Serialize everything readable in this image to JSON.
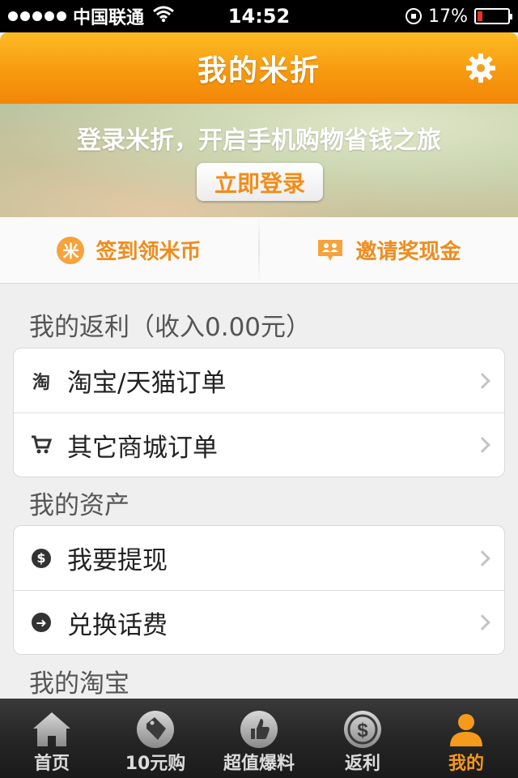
{
  "status_bar": {
    "carrier": "中国联通",
    "time": "14:52",
    "battery": "17%",
    "battery_level": 0.17
  },
  "header": {
    "title": "我的米折",
    "icon": "gear-icon"
  },
  "banner": {
    "text": "登录米折，开启手机购物省钱之旅",
    "login_label": "立即登录"
  },
  "actions": [
    {
      "label": "签到领米币",
      "icon": "mi-coin-icon",
      "icon_glyph": "米"
    },
    {
      "label": "邀请奖现金",
      "icon": "invite-icon"
    }
  ],
  "sections": [
    {
      "title": "我的返利（收入0.00元）",
      "rows": [
        {
          "label": "淘宝/天猫订单",
          "icon": "taobao-icon",
          "icon_glyph": "淘"
        },
        {
          "label": "其它商城订单",
          "icon": "cart-icon"
        }
      ]
    },
    {
      "title": "我的资产",
      "rows": [
        {
          "label": "我要提现",
          "icon": "dollar-icon",
          "icon_glyph": "$"
        },
        {
          "label": "兑换话费",
          "icon": "arrow-right-icon",
          "icon_glyph": "➜"
        }
      ]
    },
    {
      "title": "我的淘宝",
      "rows": []
    }
  ],
  "tabbar": [
    {
      "label": "首页",
      "icon": "home-icon"
    },
    {
      "label": "10元购",
      "icon": "price-tag-icon"
    },
    {
      "label": "超值爆料",
      "icon": "thumbs-up-icon"
    },
    {
      "label": "返利",
      "icon": "dollar-coin-icon"
    },
    {
      "label": "我的",
      "icon": "person-icon",
      "active": true
    }
  ],
  "colors": {
    "accent": "#f59a1a",
    "header_top": "#fdbb24",
    "header_bottom": "#f28608",
    "battery_low": "#e8322b"
  }
}
